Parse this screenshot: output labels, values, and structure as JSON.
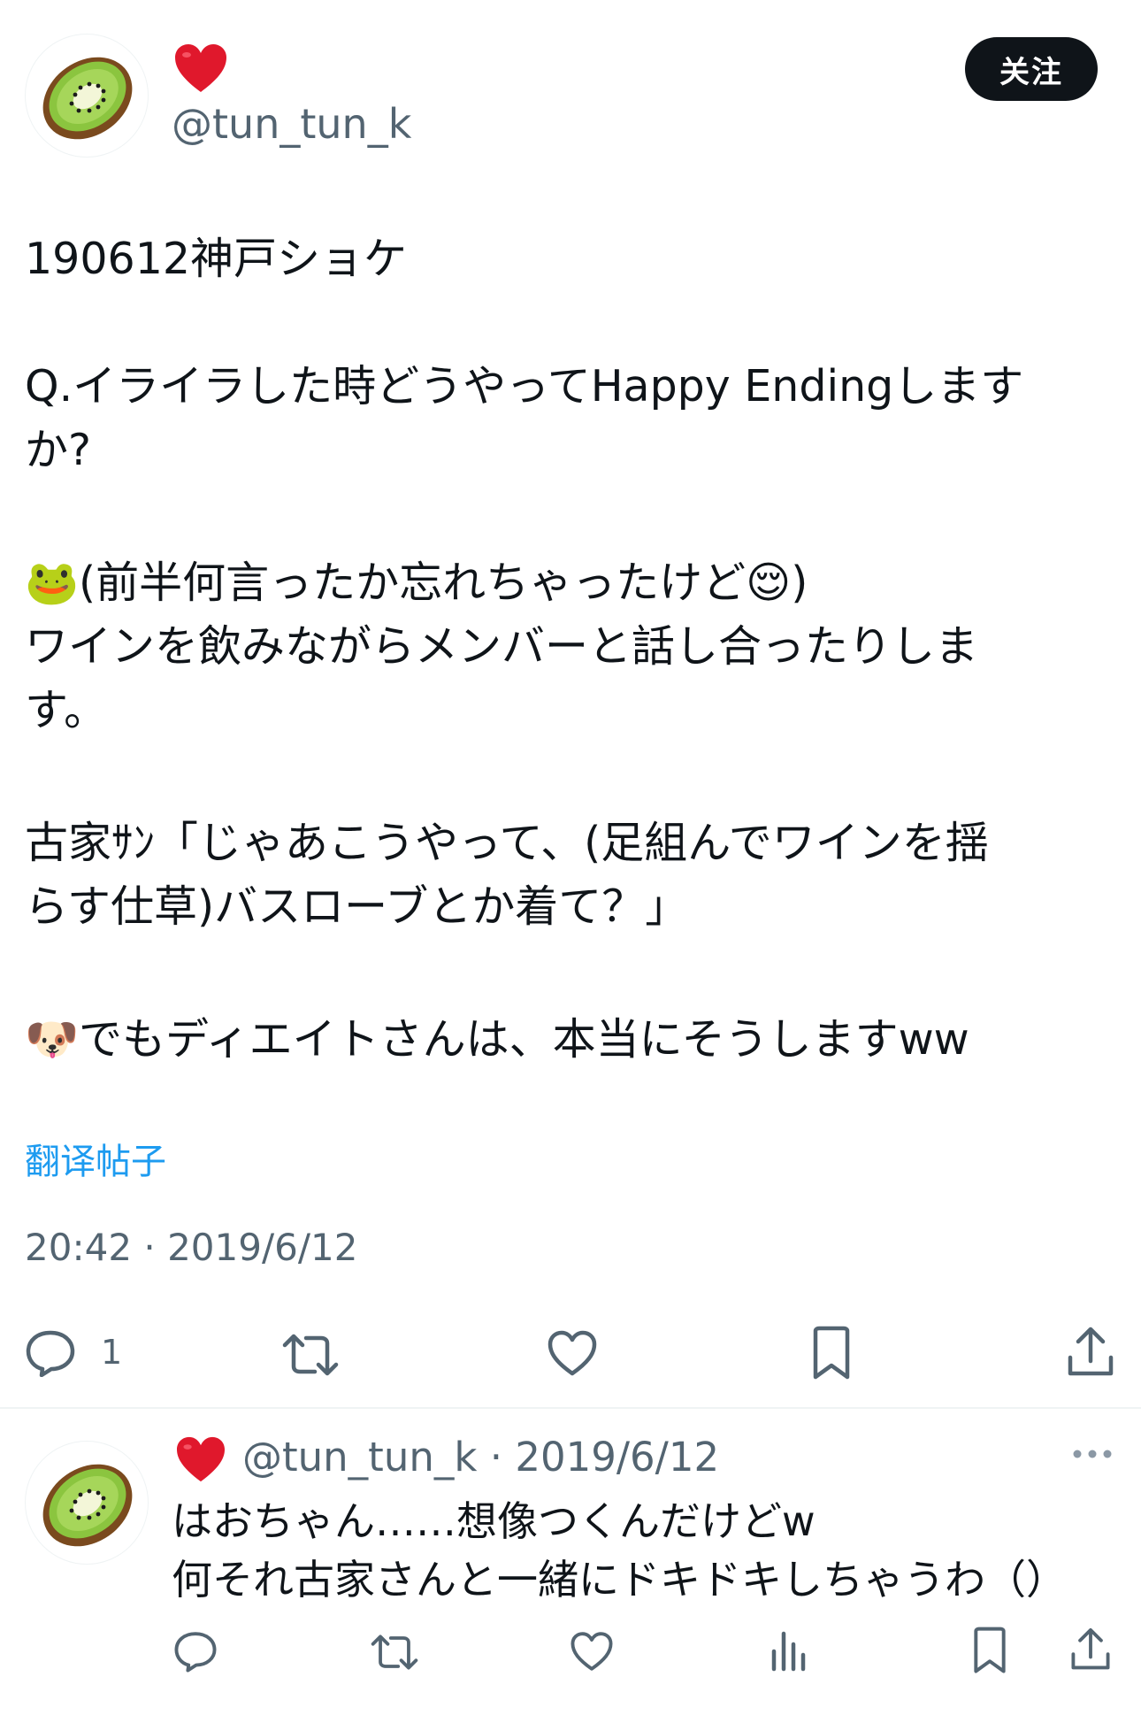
{
  "main_tweet": {
    "handle": "@tun_tun_k",
    "follow_label": "关注",
    "lines": [
      "190612神戸ショケ",
      "Q.イライラした時どうやってHappy Endingします",
      "か?",
      "🐸(前半何言ったか忘れちゃったけど😌)",
      "ワインを飲みながらメンバーと話し合ったりしま",
      "す。",
      "古家ｻﾝ「じゃあこうやって、(足組んでワインを揺",
      "らす仕草)バスローブとか着て？」",
      "🐶でもディエイトさんは、本当にそうしますww"
    ],
    "translate_label": "翻译帖子",
    "timestamp": "20:42 · 2019/6/12",
    "reply_count": "1"
  },
  "reply_tweet": {
    "header": "@tun_tun_k · 2019/6/12",
    "lines": [
      "はおちゃん……想像つくんだけどw",
      "何それ古家さんと一緒にドキドキしちゃうわ（）"
    ]
  },
  "icons": {
    "avatar": "kiwi-icon",
    "name_badge": "heart-icon",
    "reply": "reply-icon",
    "retweet": "retweet-icon",
    "like": "like-icon",
    "bookmark": "bookmark-icon",
    "share": "share-icon",
    "views": "views-icon",
    "more": "more-icon"
  },
  "colors": {
    "text": "#0f1419",
    "secondary": "#536471",
    "link": "#1d9bf0",
    "heart": "#e0182c",
    "divider": "#eff3f4"
  }
}
